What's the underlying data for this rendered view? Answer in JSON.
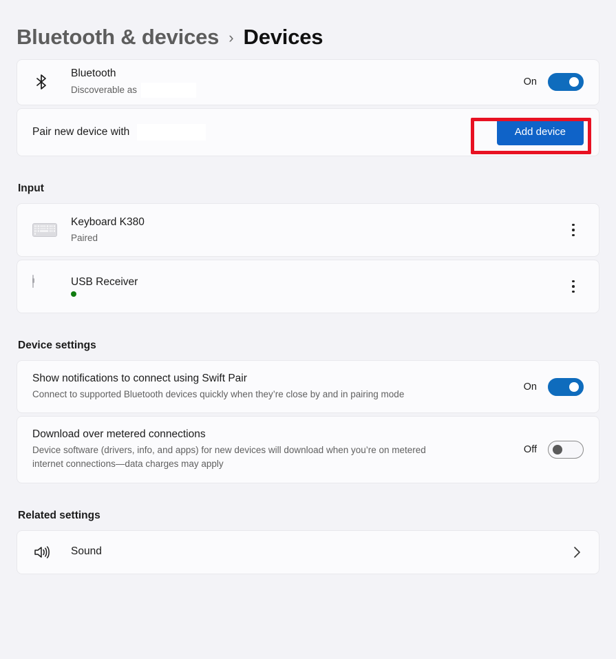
{
  "breadcrumb": {
    "parent": "Bluetooth & devices",
    "separator": "›",
    "current": "Devices"
  },
  "bluetooth": {
    "icon": "bluetooth-icon",
    "title": "Bluetooth",
    "subtitle": "Discoverable as",
    "toggle_label": "On",
    "toggle_state": "on",
    "accent_color": "#0f6cbd"
  },
  "pair": {
    "label": "Pair new device with",
    "button_label": "Add device",
    "button_color": "#0f63c8",
    "highlight_color": "#e81123"
  },
  "input_section": {
    "header": "Input",
    "devices": [
      {
        "icon": "keyboard-icon",
        "name": "Keyboard K380",
        "status": "Paired",
        "status_type": "text",
        "menu": "more-options-icon"
      },
      {
        "icon": "mouse-icon",
        "name": "USB Receiver",
        "status": "",
        "status_type": "dot",
        "status_color": "#107c10",
        "menu": "more-options-icon"
      }
    ]
  },
  "device_settings": {
    "header": "Device settings",
    "items": [
      {
        "title": "Show notifications to connect using Swift Pair",
        "description": "Connect to supported Bluetooth devices quickly when they’re close by and in pairing mode",
        "toggle_label": "On",
        "toggle_state": "on"
      },
      {
        "title": "Download over metered connections",
        "description": "Device software (drivers, info, and apps) for new devices will download when you’re on metered internet connections—data charges may apply",
        "toggle_label": "Off",
        "toggle_state": "off"
      }
    ]
  },
  "related_settings": {
    "header": "Related settings",
    "items": [
      {
        "icon": "sound-icon",
        "label": "Sound",
        "chevron": "chevron-right-icon"
      }
    ]
  }
}
